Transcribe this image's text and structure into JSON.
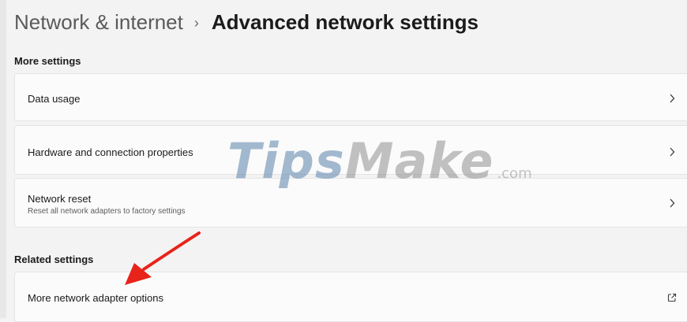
{
  "header": {
    "parent": "Network & internet",
    "separator": "›",
    "current": "Advanced network settings"
  },
  "more_settings": {
    "title": "More settings",
    "items": [
      {
        "label": "Data usage",
        "icon": "chevron-right-icon"
      },
      {
        "label": "Hardware and connection properties",
        "icon": "chevron-right-icon"
      },
      {
        "label": "Network reset",
        "description": "Reset all network adapters to factory settings",
        "icon": "chevron-right-icon"
      }
    ]
  },
  "related_settings": {
    "title": "Related settings",
    "items": [
      {
        "label": "More network adapter options",
        "icon": "external-link-icon"
      }
    ]
  },
  "watermark": {
    "tips": "Tips",
    "make": "Make",
    "com": ".com"
  },
  "colors": {
    "annotation_arrow": "#e8231a",
    "watermark_blue": "#5a82aa"
  }
}
